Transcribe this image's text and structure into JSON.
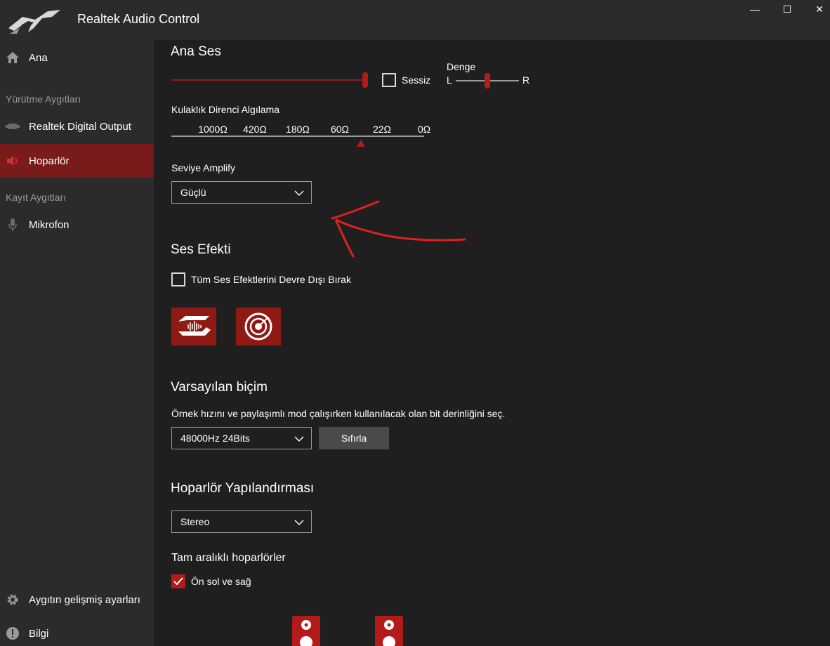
{
  "window": {
    "title": "Realtek Audio Control",
    "controls": {
      "minimize": "—",
      "maximize": "☐",
      "close": "✕"
    }
  },
  "sidebar": {
    "items": [
      {
        "label": "Ana",
        "icon": "home-icon"
      },
      {
        "label": "Realtek Digital Output",
        "icon": "digital-output-icon"
      },
      {
        "label": "Hoparlör",
        "icon": "speaker-icon",
        "active": true
      },
      {
        "label": "Mikrofon",
        "icon": "microphone-icon"
      },
      {
        "label": "Aygıtın gelişmiş ayarları",
        "icon": "gear-icon"
      },
      {
        "label": "Bilgi",
        "icon": "info-icon"
      }
    ],
    "sections": {
      "playback": "Yürütme Aygıtları",
      "recording": "Kayıt Aygıtları"
    }
  },
  "main_volume": {
    "title": "Ana Ses",
    "level": 1.0,
    "mute_label": "Sessiz",
    "mute_checked": false,
    "balance_title": "Denge",
    "balance_left": "L",
    "balance_right": "R",
    "balance_value": 0.5
  },
  "impedance": {
    "title": "Kulaklık Direnci Algılama",
    "ticks": [
      "1000Ω",
      "420Ω",
      "180Ω",
      "60Ω",
      "22Ω",
      "0Ω"
    ]
  },
  "amplify": {
    "title": "Seviye Amplify",
    "value": "Güçlü"
  },
  "sound_effects": {
    "title": "Ses Efekti",
    "disable_all_label": "Tüm Ses Efektlerini Devre Dışı Bırak",
    "disable_all_checked": false,
    "tiles": [
      "sonic-studio-icon",
      "sonic-radar-icon"
    ]
  },
  "default_format": {
    "title": "Varsayılan biçim",
    "description": "Örnek hızını ve paylaşımlı mod çalışırken kullanılacak olan bit derinliğini seç.",
    "value": "48000Hz 24Bits",
    "reset_label": "Sıfırla"
  },
  "speaker_config": {
    "title": "Hoparlör Yapılandırması",
    "value": "Stereo",
    "fullrange_title": "Tam aralıklı hoparlörler",
    "front_lr_label": "Ön sol ve sağ",
    "front_lr_checked": true
  },
  "colors": {
    "accent": "#b31b1b",
    "active_nav": "#7a1b1b",
    "sidebar": "#2b2b2b",
    "background": "#1f1f1f",
    "annotation_arrow": "#e01f1f"
  }
}
